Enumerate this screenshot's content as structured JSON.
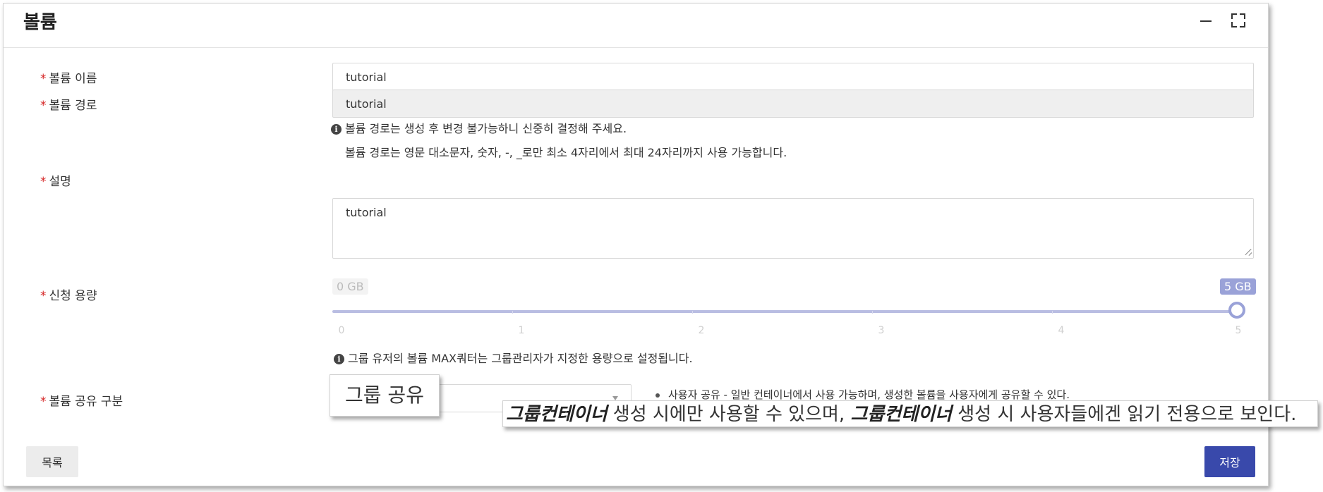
{
  "panel": {
    "title": "볼륨"
  },
  "form": {
    "name": {
      "label": "볼륨 이름",
      "value": "tutorial"
    },
    "path": {
      "label": "볼륨 경로",
      "value": "tutorial",
      "note1": "볼륨 경로는 생성 후 변경 불가능하니 신중히 결정해 주세요.",
      "note2": "볼륨 경로는 영문 대소문자, 숫자, -, _로만 최소 4자리에서 최대 24자리까지 사용 가능합니다."
    },
    "description": {
      "label": "설명",
      "value": "tutorial"
    },
    "capacity": {
      "label": "신청 용량",
      "min_label": "0 GB",
      "max_label": "5 GB",
      "ticks": [
        "0",
        "1",
        "2",
        "3",
        "4",
        "5"
      ],
      "value": 5,
      "min": 0,
      "max": 5,
      "note": "그룹 유저의 볼륨 MAX쿼터는 그룹관리자가 지정한 용량으로 설정됩니다."
    },
    "share": {
      "label": "볼륨 공유 구분",
      "selected": "그룹 공유",
      "bullet": "사용자 공유 - 일반 컨테이너에서 사용 가능하며, 생성한 볼륨을 사용자에게 공유할 수 있다.",
      "banner": {
        "bold1": "그룹컨테이너",
        "text1": " 생성 시에만 사용할 수 있으며, ",
        "bold2": "그룹컨테이너",
        "text2": " 생성 시 사용자들에겐 읽기 전용으로 보인다."
      }
    }
  },
  "footer": {
    "list_label": "목록",
    "save_label": "저장"
  },
  "colors": {
    "primary": "#3949ab",
    "slider": "#9aa2d8",
    "required": "#d42020"
  },
  "icons": [
    "minimize-icon",
    "fullscreen-icon",
    "info-icon",
    "chevron-down-icon"
  ]
}
